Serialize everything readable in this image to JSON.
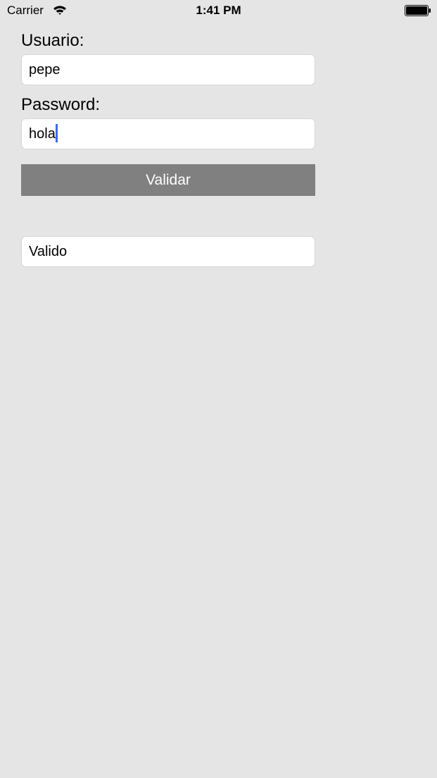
{
  "status_bar": {
    "carrier": "Carrier",
    "time": "1:41 PM",
    "wifi_icon": "wifi-icon",
    "battery_icon": "battery-icon"
  },
  "form": {
    "user_label": "Usuario:",
    "user_value": "pepe",
    "password_label": "Password:",
    "password_value": "hola",
    "validate_label": "Validar",
    "result_value": "Valido"
  },
  "colors": {
    "background": "#e5e5e5",
    "button": "#808080",
    "caret": "#3f6be0"
  }
}
